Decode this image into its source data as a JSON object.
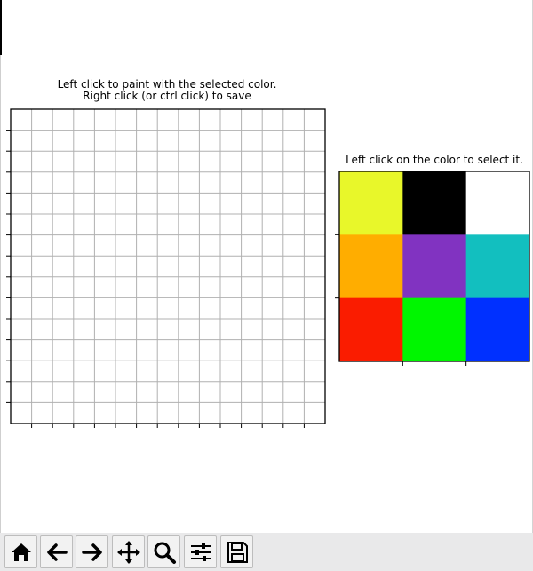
{
  "canvas": {
    "title_line1": "Left click to paint with the selected color.",
    "title_line2": "Right click (or ctrl click) to save",
    "grid_columns": 15,
    "grid_rows": 15
  },
  "palette": {
    "title": "Left click on the color to select it.",
    "colors": [
      [
        "#e8f72a",
        "#000000",
        "#ffffff"
      ],
      [
        "#ffad00",
        "#8133c1",
        "#12bfbf"
      ],
      [
        "#fa1c00",
        "#00f600",
        "#0030ff"
      ]
    ]
  },
  "toolbar": {
    "buttons": [
      {
        "name": "home-button",
        "icon": "home-icon"
      },
      {
        "name": "back-button",
        "icon": "arrow-left-icon"
      },
      {
        "name": "forward-button",
        "icon": "arrow-right-icon"
      },
      {
        "name": "pan-button",
        "icon": "move-icon"
      },
      {
        "name": "zoom-button",
        "icon": "magnifier-icon"
      },
      {
        "name": "configure-subplots-button",
        "icon": "sliders-icon"
      },
      {
        "name": "save-button",
        "icon": "floppy-disk-icon"
      }
    ]
  }
}
